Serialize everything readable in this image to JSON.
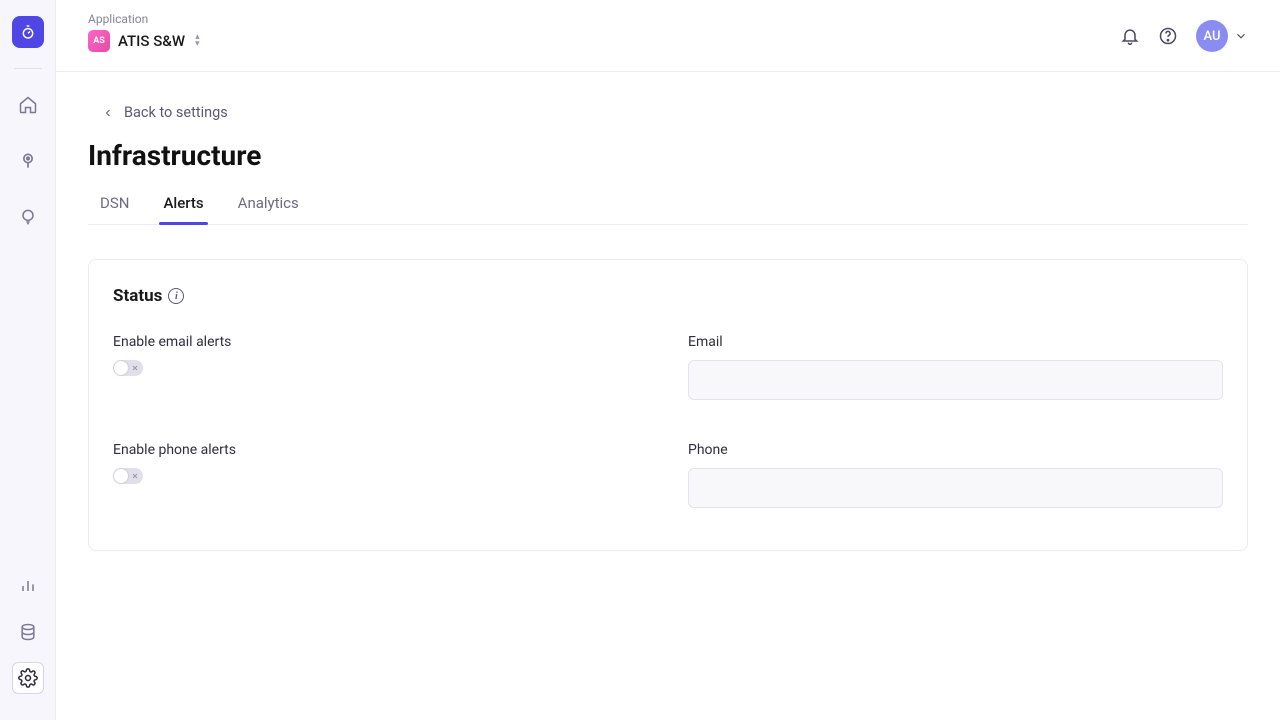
{
  "header": {
    "app_label": "Application",
    "app_badge": "AS",
    "app_name": "ATIS S&W",
    "avatar_initials": "AU"
  },
  "nav": {
    "back_label": "Back to settings",
    "page_title": "Infrastructure",
    "tabs": [
      {
        "label": "DSN",
        "active": false
      },
      {
        "label": "Alerts",
        "active": true
      },
      {
        "label": "Analytics",
        "active": false
      }
    ]
  },
  "card": {
    "title": "Status",
    "rows": [
      {
        "toggle_label": "Enable email alerts",
        "toggle_on": false,
        "input_label": "Email",
        "input_value": ""
      },
      {
        "toggle_label": "Enable phone alerts",
        "toggle_on": false,
        "input_label": "Phone",
        "input_value": ""
      }
    ]
  }
}
